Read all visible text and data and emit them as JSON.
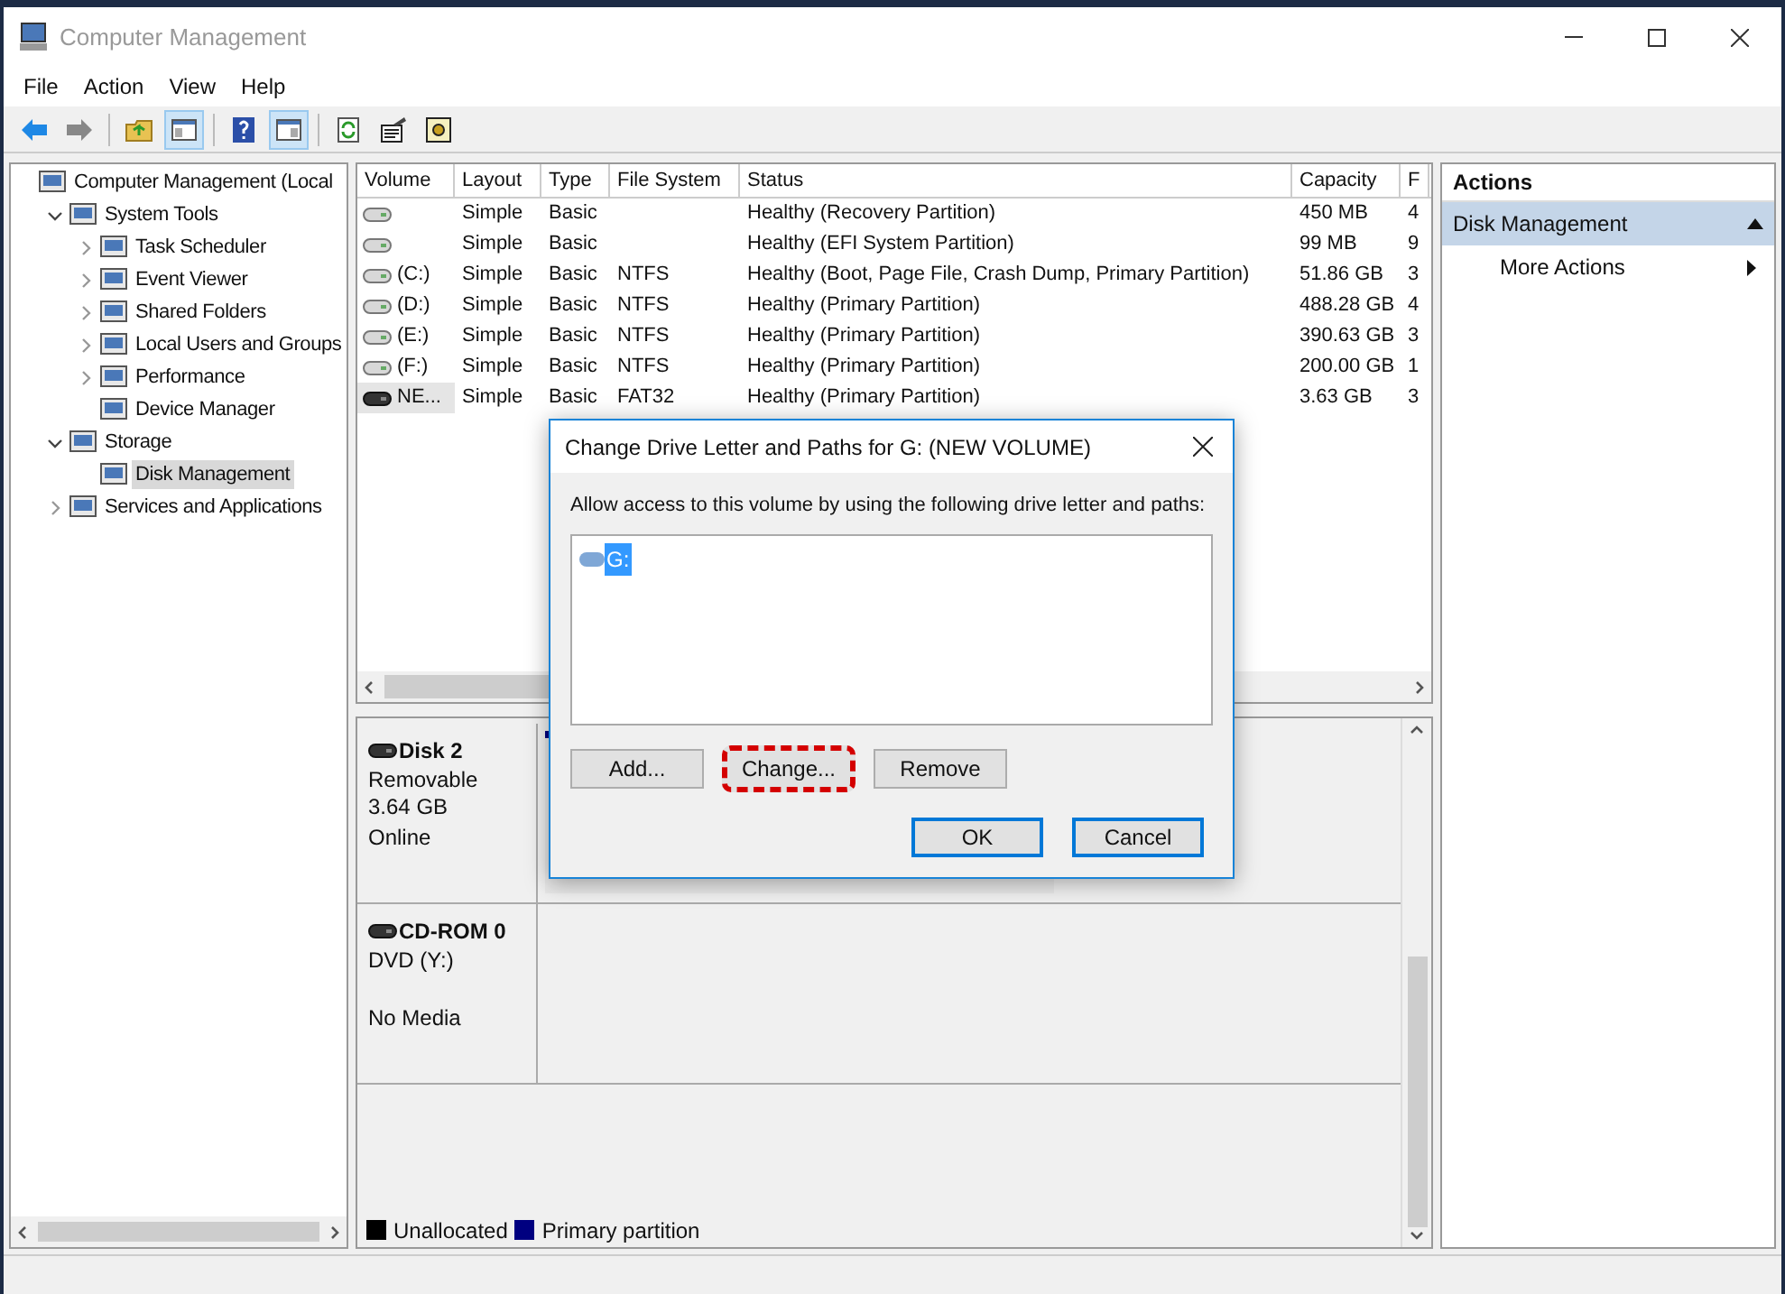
{
  "window": {
    "title": "Computer Management"
  },
  "menu": [
    "File",
    "Action",
    "View",
    "Help"
  ],
  "toolbar": [
    {
      "buttons": [
        {
          "kind": "back",
          "pressed": false
        },
        {
          "kind": "forward",
          "pressed": false
        }
      ]
    },
    {
      "buttons": [
        {
          "kind": "up",
          "pressed": false
        },
        {
          "kind": "tree",
          "pressed": true
        }
      ]
    },
    {
      "buttons": [
        {
          "kind": "help",
          "pressed": false
        },
        {
          "kind": "pane",
          "pressed": true
        }
      ]
    },
    {
      "buttons": [
        {
          "kind": "refresh",
          "pressed": false
        },
        {
          "kind": "properties",
          "pressed": false
        },
        {
          "kind": "settings",
          "pressed": false
        }
      ]
    }
  ],
  "tree": [
    {
      "label": "Computer Management (Local",
      "selected": false,
      "children": [
        {
          "label": "System Tools",
          "expanded": true,
          "selected": false,
          "children": [
            {
              "label": "Task Scheduler",
              "expanded": false,
              "selected": false
            },
            {
              "label": "Event Viewer",
              "expanded": false,
              "selected": false
            },
            {
              "label": "Shared Folders",
              "expanded": false,
              "selected": false
            },
            {
              "label": "Local Users and Groups",
              "expanded": false,
              "selected": false
            },
            {
              "label": "Performance",
              "expanded": false,
              "selected": false
            },
            {
              "label": "Device Manager",
              "selected": false
            }
          ]
        },
        {
          "label": "Storage",
          "expanded": true,
          "selected": false,
          "children": [
            {
              "label": "Disk Management",
              "selected": true
            }
          ]
        },
        {
          "label": "Services and Applications",
          "expanded": false,
          "selected": false
        }
      ]
    }
  ],
  "table": {
    "columns": [
      "Volume",
      "Layout",
      "Type",
      "File System",
      "Status",
      "Capacity",
      "F"
    ],
    "rows": [
      {
        "selected": false,
        "cells": [
          "",
          "Simple",
          "Basic",
          "",
          "Healthy (Recovery Partition)",
          "450 MB",
          "4"
        ]
      },
      {
        "selected": false,
        "cells": [
          "",
          "Simple",
          "Basic",
          "",
          "Healthy (EFI System Partition)",
          "99 MB",
          "9"
        ]
      },
      {
        "selected": false,
        "cells": [
          "(C:)",
          "Simple",
          "Basic",
          "NTFS",
          "Healthy (Boot, Page File, Crash Dump, Primary Partition)",
          "51.86 GB",
          "3"
        ]
      },
      {
        "selected": false,
        "cells": [
          "(D:)",
          "Simple",
          "Basic",
          "NTFS",
          "Healthy (Primary Partition)",
          "488.28 GB",
          "4"
        ]
      },
      {
        "selected": false,
        "cells": [
          "(E:)",
          "Simple",
          "Basic",
          "NTFS",
          "Healthy (Primary Partition)",
          "390.63 GB",
          "3"
        ]
      },
      {
        "selected": false,
        "cells": [
          "(F:)",
          "Simple",
          "Basic",
          "NTFS",
          "Healthy (Primary Partition)",
          "200.00 GB",
          "1"
        ]
      },
      {
        "selected": true,
        "cells": [
          "NE...",
          "Simple",
          "Basic",
          "FAT32",
          "Healthy (Primary Partition)",
          "3.63 GB",
          "3"
        ]
      }
    ]
  },
  "disks": [
    {
      "name": "Disk 2",
      "info": [
        "Removable",
        "3.64 GB"
      ],
      "status": "Online"
    },
    {
      "name": "CD-ROM 0",
      "info": [
        "DVD (Y:)"
      ],
      "status": "No Media"
    }
  ],
  "legend": [
    {
      "label": "Unallocated",
      "color": "#000000"
    },
    {
      "label": "Primary partition",
      "color": "#000080"
    }
  ],
  "actions": {
    "title": "Actions",
    "section": {
      "label": "Disk Management",
      "expanded": true
    },
    "items": [
      "More Actions"
    ]
  },
  "dialog": {
    "title": "Change Drive Letter and Paths for G: (NEW VOLUME)",
    "instruction": "Allow access to this volume by using the following drive letter and paths:",
    "paths": [
      {
        "label": "G:",
        "selected": true
      }
    ],
    "buttons": [
      {
        "label": "Add...",
        "highlighted": false
      },
      {
        "label": "Change...",
        "highlighted": true
      },
      {
        "label": "Remove",
        "highlighted": false
      }
    ],
    "ok": "OK",
    "cancel": "Cancel"
  }
}
